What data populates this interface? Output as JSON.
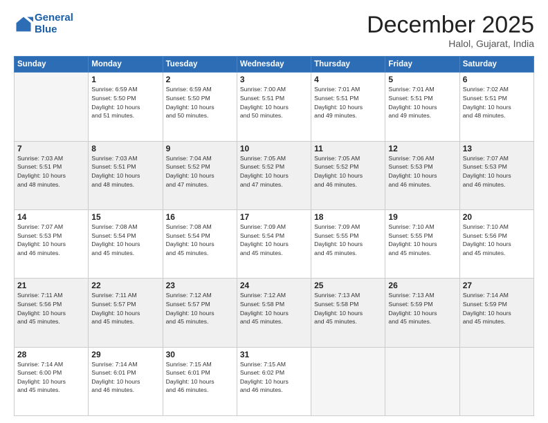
{
  "logo": {
    "line1": "General",
    "line2": "Blue"
  },
  "title": "December 2025",
  "location": "Halol, Gujarat, India",
  "weekdays": [
    "Sunday",
    "Monday",
    "Tuesday",
    "Wednesday",
    "Thursday",
    "Friday",
    "Saturday"
  ],
  "weeks": [
    [
      {
        "day": "",
        "info": ""
      },
      {
        "day": "1",
        "info": "Sunrise: 6:59 AM\nSunset: 5:50 PM\nDaylight: 10 hours\nand 51 minutes."
      },
      {
        "day": "2",
        "info": "Sunrise: 6:59 AM\nSunset: 5:50 PM\nDaylight: 10 hours\nand 50 minutes."
      },
      {
        "day": "3",
        "info": "Sunrise: 7:00 AM\nSunset: 5:51 PM\nDaylight: 10 hours\nand 50 minutes."
      },
      {
        "day": "4",
        "info": "Sunrise: 7:01 AM\nSunset: 5:51 PM\nDaylight: 10 hours\nand 49 minutes."
      },
      {
        "day": "5",
        "info": "Sunrise: 7:01 AM\nSunset: 5:51 PM\nDaylight: 10 hours\nand 49 minutes."
      },
      {
        "day": "6",
        "info": "Sunrise: 7:02 AM\nSunset: 5:51 PM\nDaylight: 10 hours\nand 48 minutes."
      }
    ],
    [
      {
        "day": "7",
        "info": "Sunrise: 7:03 AM\nSunset: 5:51 PM\nDaylight: 10 hours\nand 48 minutes."
      },
      {
        "day": "8",
        "info": "Sunrise: 7:03 AM\nSunset: 5:51 PM\nDaylight: 10 hours\nand 48 minutes."
      },
      {
        "day": "9",
        "info": "Sunrise: 7:04 AM\nSunset: 5:52 PM\nDaylight: 10 hours\nand 47 minutes."
      },
      {
        "day": "10",
        "info": "Sunrise: 7:05 AM\nSunset: 5:52 PM\nDaylight: 10 hours\nand 47 minutes."
      },
      {
        "day": "11",
        "info": "Sunrise: 7:05 AM\nSunset: 5:52 PM\nDaylight: 10 hours\nand 46 minutes."
      },
      {
        "day": "12",
        "info": "Sunrise: 7:06 AM\nSunset: 5:53 PM\nDaylight: 10 hours\nand 46 minutes."
      },
      {
        "day": "13",
        "info": "Sunrise: 7:07 AM\nSunset: 5:53 PM\nDaylight: 10 hours\nand 46 minutes."
      }
    ],
    [
      {
        "day": "14",
        "info": "Sunrise: 7:07 AM\nSunset: 5:53 PM\nDaylight: 10 hours\nand 46 minutes."
      },
      {
        "day": "15",
        "info": "Sunrise: 7:08 AM\nSunset: 5:54 PM\nDaylight: 10 hours\nand 45 minutes."
      },
      {
        "day": "16",
        "info": "Sunrise: 7:08 AM\nSunset: 5:54 PM\nDaylight: 10 hours\nand 45 minutes."
      },
      {
        "day": "17",
        "info": "Sunrise: 7:09 AM\nSunset: 5:54 PM\nDaylight: 10 hours\nand 45 minutes."
      },
      {
        "day": "18",
        "info": "Sunrise: 7:09 AM\nSunset: 5:55 PM\nDaylight: 10 hours\nand 45 minutes."
      },
      {
        "day": "19",
        "info": "Sunrise: 7:10 AM\nSunset: 5:55 PM\nDaylight: 10 hours\nand 45 minutes."
      },
      {
        "day": "20",
        "info": "Sunrise: 7:10 AM\nSunset: 5:56 PM\nDaylight: 10 hours\nand 45 minutes."
      }
    ],
    [
      {
        "day": "21",
        "info": "Sunrise: 7:11 AM\nSunset: 5:56 PM\nDaylight: 10 hours\nand 45 minutes."
      },
      {
        "day": "22",
        "info": "Sunrise: 7:11 AM\nSunset: 5:57 PM\nDaylight: 10 hours\nand 45 minutes."
      },
      {
        "day": "23",
        "info": "Sunrise: 7:12 AM\nSunset: 5:57 PM\nDaylight: 10 hours\nand 45 minutes."
      },
      {
        "day": "24",
        "info": "Sunrise: 7:12 AM\nSunset: 5:58 PM\nDaylight: 10 hours\nand 45 minutes."
      },
      {
        "day": "25",
        "info": "Sunrise: 7:13 AM\nSunset: 5:58 PM\nDaylight: 10 hours\nand 45 minutes."
      },
      {
        "day": "26",
        "info": "Sunrise: 7:13 AM\nSunset: 5:59 PM\nDaylight: 10 hours\nand 45 minutes."
      },
      {
        "day": "27",
        "info": "Sunrise: 7:14 AM\nSunset: 5:59 PM\nDaylight: 10 hours\nand 45 minutes."
      }
    ],
    [
      {
        "day": "28",
        "info": "Sunrise: 7:14 AM\nSunset: 6:00 PM\nDaylight: 10 hours\nand 45 minutes."
      },
      {
        "day": "29",
        "info": "Sunrise: 7:14 AM\nSunset: 6:01 PM\nDaylight: 10 hours\nand 46 minutes."
      },
      {
        "day": "30",
        "info": "Sunrise: 7:15 AM\nSunset: 6:01 PM\nDaylight: 10 hours\nand 46 minutes."
      },
      {
        "day": "31",
        "info": "Sunrise: 7:15 AM\nSunset: 6:02 PM\nDaylight: 10 hours\nand 46 minutes."
      },
      {
        "day": "",
        "info": ""
      },
      {
        "day": "",
        "info": ""
      },
      {
        "day": "",
        "info": ""
      }
    ]
  ]
}
